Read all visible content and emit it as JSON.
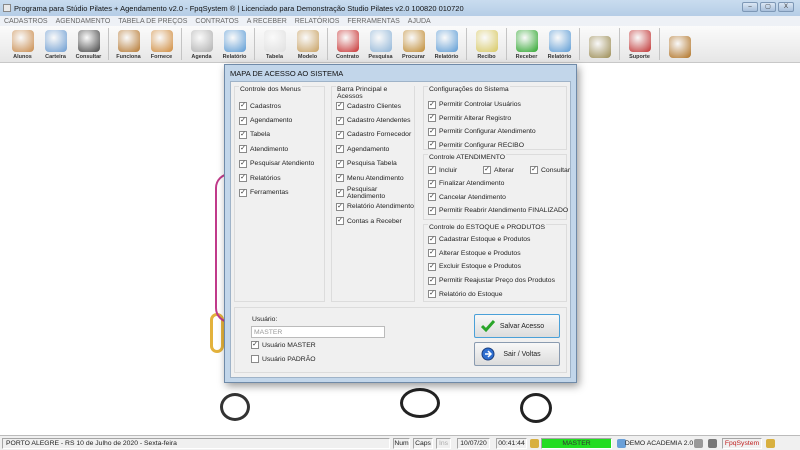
{
  "window": {
    "title": "Programa para Stúdio Pilates + Agendamento v2.0 - FpqSystem ® | Licenciado para  Demonstração Studio Pilates v2.0 100820 010720",
    "controls": [
      "–",
      "▢",
      "X"
    ]
  },
  "menu": [
    "CADASTROS",
    "AGENDAMENTO",
    "TABELA DE PREÇOS",
    "CONTRATOS",
    "A RECEBER",
    "RELATÓRIOS",
    "FERRAMENTAS",
    "AJUDA"
  ],
  "toolbar": [
    {
      "label": "Alunos",
      "icon": "students-icon",
      "color": "#c98a4a"
    },
    {
      "label": "Carteira",
      "icon": "id-card-icon",
      "color": "#6a9bd1"
    },
    {
      "label": "Consultar",
      "icon": "id-document-icon",
      "color": "#444444"
    },
    {
      "label": "Funciona",
      "icon": "employees-icon",
      "color": "#b5772f",
      "sep": true
    },
    {
      "label": "Fornece",
      "icon": "supplier-icon",
      "color": "#d08a3a"
    },
    {
      "label": "Agenda",
      "icon": "calendar-icon",
      "color": "#b0b0b0",
      "sep": true
    },
    {
      "label": "Relatório",
      "icon": "printer-icon",
      "color": "#5b9bd5"
    },
    {
      "label": "Tabela",
      "icon": "price-table-icon",
      "color": "#e0e0e0",
      "sep": true
    },
    {
      "label": "Modelo",
      "icon": "scroll-icon",
      "color": "#c8a060"
    },
    {
      "label": "Contrato",
      "icon": "contract-pen-icon",
      "color": "#c83030",
      "sep": true
    },
    {
      "label": "Pesquisa",
      "icon": "search-document-icon",
      "color": "#8fb5d8"
    },
    {
      "label": "Procurar",
      "icon": "file-box-icon",
      "color": "#c08a30"
    },
    {
      "label": "Relatório",
      "icon": "printer-icon",
      "color": "#5b9bd5"
    },
    {
      "label": "Recibo",
      "icon": "receipt-icon",
      "color": "#d8c860",
      "sep": true
    },
    {
      "label": "Receber",
      "icon": "dollar-icon",
      "color": "#2aa52a",
      "sep": true
    },
    {
      "label": "Relatório",
      "icon": "printer-icon",
      "color": "#5b9bd5"
    },
    {
      "label": "",
      "icon": "coin-icon",
      "color": "#9a8a50",
      "sep": true
    },
    {
      "label": "Suporte",
      "icon": "support-agent-icon",
      "color": "#c03030",
      "sep": true
    },
    {
      "label": "",
      "icon": "exit-door-icon",
      "color": "#b07020",
      "sep": true
    }
  ],
  "dialog": {
    "title": "MAPA DE ACESSO AO SISTEMA",
    "menus": {
      "title": "Controle dos Menus",
      "items": [
        "Cadastros",
        "Agendamento",
        "Tabela",
        "Atendimento",
        "Pesquisar Atendiento",
        "Relatórios",
        "Ferramentas"
      ]
    },
    "barra": {
      "title": "Barra Principal e Acessos",
      "items": [
        "Cadastro Clientes",
        "Cadastro Atendentes",
        "Cadastro Fornecedor",
        "Agendamento",
        "Pesquisa Tabela",
        "Menu Atendimento",
        "Pesquisar Atendimento",
        "Relatório Atendimento",
        "Contas a Receber"
      ]
    },
    "config": {
      "title": "Configurações do Sistema",
      "items": [
        "Permitir Controlar Usuários",
        "Permitir Alterar Registro",
        "Permitir Configurar Atendimento",
        "Permitir Configurar RECIBO"
      ]
    },
    "atendimento": {
      "title": "Controle ATENDIMENTO",
      "inline": [
        "Incluir",
        "Alterar",
        "Consultar"
      ],
      "items": [
        "Finalizar Atendimento",
        "Cancelar Atendimento",
        "Permitir Reabrir Atendimento FINALIZADO"
      ]
    },
    "estoque": {
      "title": "Controle do ESTOQUE e PRODUTOS",
      "items": [
        "Cadastrar Estoque e Produtos",
        "Alterar Estoque e Produtos",
        "Excluir Estoque e Produtos",
        "Permitir Reajustar Preço dos Produtos",
        "Relatório do Estoque"
      ]
    },
    "usuario": {
      "label": "Usuário:",
      "value": "MASTER",
      "master": "Usuário MASTER",
      "master_checked": true,
      "padrao": "Usuário PADRÃO",
      "padrao_checked": false
    },
    "save": "Salvar Acesso",
    "exit": "Sair / Voltas"
  },
  "status": {
    "location": "PORTO ALEGRE - RS 10 de Julho de 2020 - Sexta-feira",
    "num": "Num",
    "caps": "Caps",
    "ins": "Ins",
    "date": "10/07/20",
    "time": "00:41:44",
    "user": "MASTER",
    "user_color": "#22dd22",
    "company": "DEMO ACADEMIA 2.0",
    "brand": "FpqSystem"
  }
}
